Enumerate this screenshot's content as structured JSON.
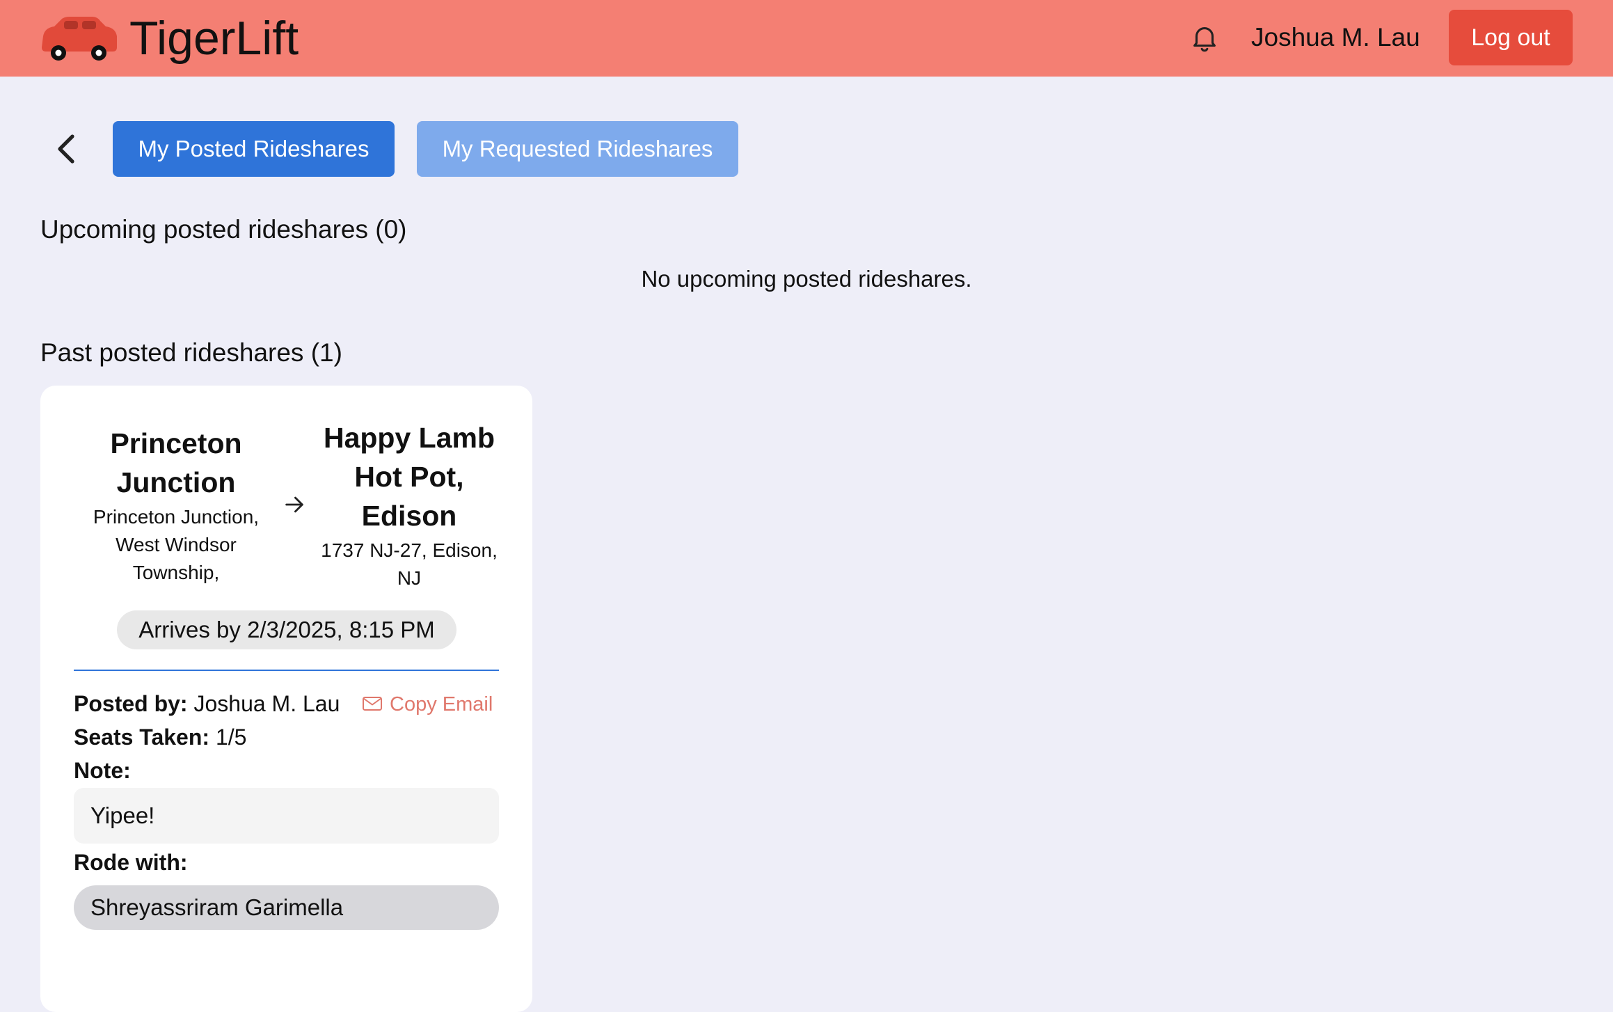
{
  "header": {
    "brand": "TigerLift",
    "user_name": "Joshua M. Lau",
    "logout_label": "Log out",
    "bg_color": "#f47f73",
    "logout_color": "#e64c3c"
  },
  "nav": {
    "tabs": [
      {
        "label": "My Posted Rideshares",
        "active": true
      },
      {
        "label": "My Requested Rideshares",
        "active": false
      }
    ]
  },
  "upcoming": {
    "title": "Upcoming posted rideshares (0)",
    "empty_message": "No upcoming posted rideshares."
  },
  "past": {
    "title": "Past posted rideshares (1)",
    "rides": [
      {
        "origin": {
          "name_line1": "Princeton",
          "name_line2": "Junction",
          "addr_line1": "Princeton Junction,",
          "addr_line2": "West Windsor",
          "addr_line3": "Township,"
        },
        "destination": {
          "name_line1": "Happy Lamb",
          "name_line2": "Hot Pot,",
          "name_line3": "Edison",
          "addr_line1": "1737 NJ-27, Edison,",
          "addr_line2": "NJ"
        },
        "arrival": "Arrives by 2/3/2025, 8:15 PM",
        "posted_by_label": "Posted by:",
        "posted_by": "Joshua M. Lau",
        "copy_email_label": "Copy Email",
        "seats_label": "Seats Taken:",
        "seats": "1/5",
        "note_label": "Note:",
        "note": "Yipee!",
        "rode_with_label": "Rode with:",
        "rode_with": [
          "Shreyassriram Garimella"
        ]
      }
    ]
  },
  "icons": {
    "logo": "car-icon",
    "notifications": "bell-icon",
    "back": "chevron-left-icon",
    "route": "arrow-right-icon",
    "email": "envelope-icon"
  },
  "colors": {
    "page_bg": "#eeeef8",
    "primary": "#2f74d9",
    "primary_light": "#7eaaec",
    "accent_text": "#e0786c"
  }
}
